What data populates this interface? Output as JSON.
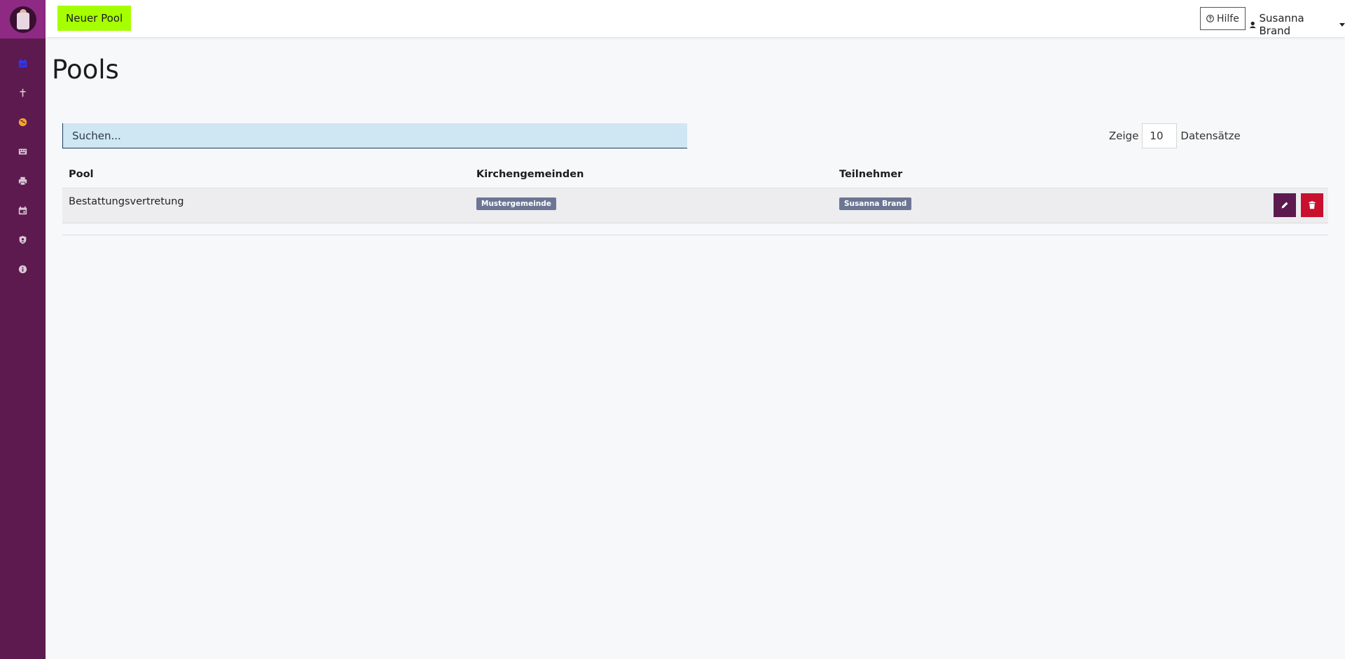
{
  "sidebar": {
    "items": [
      {
        "icon": "calendar-icon",
        "color": "#2a3aff"
      },
      {
        "icon": "cross-icon",
        "color": "#d8c8d4"
      },
      {
        "icon": "globe-icon",
        "color": "#f5a623"
      },
      {
        "icon": "keyboard-icon",
        "color": "#d8c8d4"
      },
      {
        "icon": "printer-icon",
        "color": "#d8c8d4"
      },
      {
        "icon": "calendar-event-icon",
        "color": "#d8c8d4"
      },
      {
        "icon": "shield-user-icon",
        "color": "#d8c8d4"
      },
      {
        "icon": "info-icon",
        "color": "#d8c8d4"
      }
    ]
  },
  "topbar": {
    "new_button_label": "Neuer Pool",
    "help_label": "Hilfe",
    "user_name": "Susanna Brand"
  },
  "main": {
    "title": "Pools",
    "search_placeholder": "Suchen...",
    "length_prefix": "Zeige",
    "length_value": "10",
    "length_suffix": "Datensätze",
    "table": {
      "headers": [
        "Pool",
        "Kirchengemeinden",
        "Teilnehmer"
      ],
      "rows": [
        {
          "pool": "Bestattungsvertretung",
          "gemeinde": "Mustergemeinde",
          "teilnehmer": "Susanna Brand"
        }
      ]
    }
  },
  "colors": {
    "sidebar_bg": "#5c1a4f",
    "logo_bg": "#8e2a83",
    "new_button_bg": "#a6ff00",
    "edit_button_bg": "#5c1a4f",
    "delete_button_bg": "#c8102e",
    "badge_bg": "#6c7694",
    "search_bg": "#cfe6f3"
  }
}
